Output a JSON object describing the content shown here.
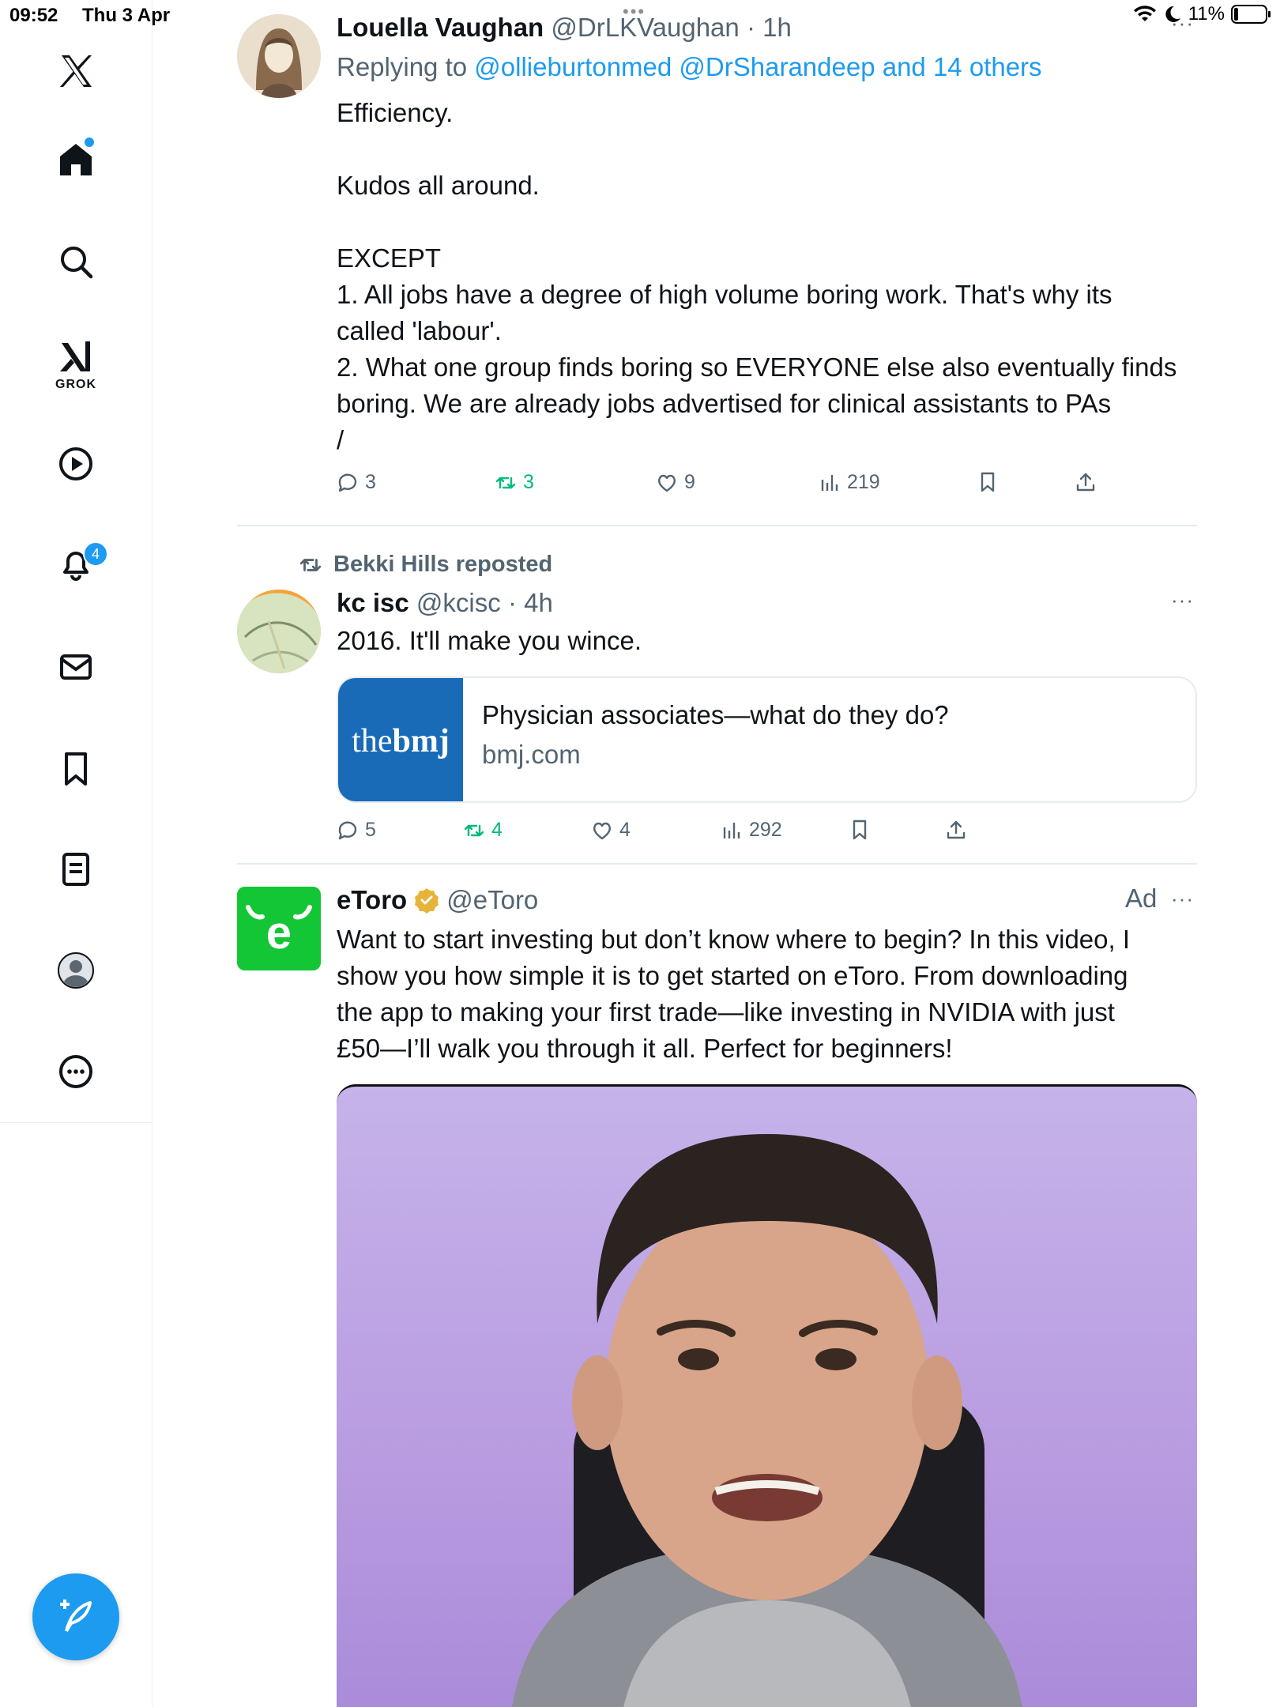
{
  "status_bar": {
    "time": "09:52",
    "date": "Thu 3 Apr",
    "battery_pct": "11%",
    "icons": [
      "wifi-icon",
      "moon-icon",
      "battery-icon"
    ]
  },
  "sidebar": {
    "items": [
      {
        "name": "x-logo-icon"
      },
      {
        "name": "home-icon"
      },
      {
        "name": "search-icon"
      },
      {
        "name": "grok-icon",
        "label": "GROK"
      },
      {
        "name": "video-icon"
      },
      {
        "name": "notifications-icon",
        "badge": "4"
      },
      {
        "name": "messages-icon"
      },
      {
        "name": "bookmarks-icon"
      },
      {
        "name": "lists-icon"
      },
      {
        "name": "profile-icon"
      },
      {
        "name": "more-icon"
      }
    ],
    "compose": "compose-icon"
  },
  "tweets": [
    {
      "author": "Louella Vaughan",
      "handle": "@DrLKVaughan",
      "time": "· 1h",
      "reply_prefix": "Replying to",
      "reply_to": "@ollieburtonmed @DrSharandeep and 14 others",
      "lines": [
        "Efficiency.",
        "",
        "Kudos all around.",
        "",
        "EXCEPT",
        "1. All jobs have a degree of high volume boring work. That's why its",
        "called 'labour'.",
        "2. What one group finds boring so EVERYONE else also eventually finds",
        "boring. We are already jobs advertised for clinical assistants to PAs",
        "/"
      ],
      "replies": "3",
      "reposts": "3",
      "likes": "9",
      "views": "219"
    },
    {
      "repost_label": "Bekki Hills reposted",
      "author": "kc isc",
      "handle": "@kcisc",
      "time": "· 4h",
      "text": "2016. It'll make you wince.",
      "card": {
        "logo_light": "the",
        "logo_bold": "bmj",
        "title": "Physician associates—what do they do?",
        "domain": "bmj.com"
      },
      "replies": "5",
      "reposts": "4",
      "likes": "4",
      "views": "292"
    },
    {
      "author": "eToro",
      "handle": "@eToro",
      "ad_label": "Ad",
      "lines": [
        "Want to start investing but don’t know where to begin? In this video, I",
        "show you how simple it is to get started on eToro. From downloading",
        "the app to making your first trade—like investing in NVIDIA with just",
        "£50—I’ll walk you through it all. Perfect for beginners!"
      ],
      "avatar_letter": "e"
    }
  ],
  "colors": {
    "accent": "#1d9bf0",
    "repost_green": "#00ba7c",
    "muted": "#536471",
    "etoro_green": "#13c636",
    "bmj_blue": "#1a6bb7"
  }
}
